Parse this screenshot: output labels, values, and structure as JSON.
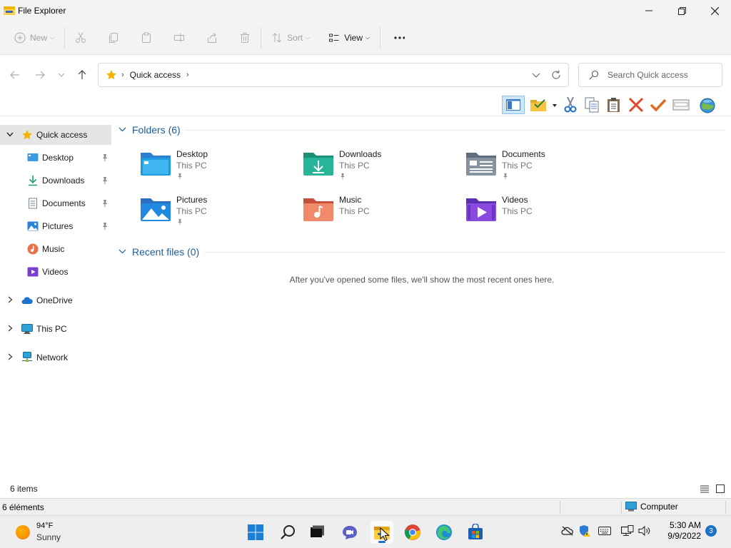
{
  "window": {
    "title": "File Explorer",
    "icon": "file-explorer-icon"
  },
  "commandbar": {
    "new_label": "New",
    "sort_label": "Sort",
    "view_label": "View",
    "icons": [
      "new-icon",
      "cut-icon",
      "copy-icon",
      "paste-icon",
      "rename-icon",
      "share-icon",
      "delete-icon",
      "sort-icon",
      "view-icon",
      "more-icon"
    ]
  },
  "address": {
    "crumb": "Quick access",
    "search_placeholder": "Search Quick access"
  },
  "legacy_toolbar": {
    "icons": [
      "details-pane-icon",
      "folder-check-icon",
      "cut-icon",
      "copy-icon",
      "paste-icon",
      "delete-icon",
      "check-icon",
      "properties-icon",
      "globe-icon"
    ]
  },
  "nav": {
    "quick_access": "Quick access",
    "items": [
      {
        "label": "Desktop",
        "icon": "desktop-icon",
        "pinned": true
      },
      {
        "label": "Downloads",
        "icon": "downloads-icon",
        "pinned": true
      },
      {
        "label": "Documents",
        "icon": "documents-icon",
        "pinned": true
      },
      {
        "label": "Pictures",
        "icon": "pictures-icon",
        "pinned": true
      },
      {
        "label": "Music",
        "icon": "music-icon",
        "pinned": false
      },
      {
        "label": "Videos",
        "icon": "videos-icon",
        "pinned": false
      }
    ],
    "roots": [
      {
        "label": "OneDrive",
        "icon": "onedrive-icon"
      },
      {
        "label": "This PC",
        "icon": "this-pc-icon"
      },
      {
        "label": "Network",
        "icon": "network-icon"
      }
    ]
  },
  "content": {
    "folders_header": "Folders (6)",
    "recent_header": "Recent files (0)",
    "empty_message": "After you've opened some files, we'll show the most recent ones here.",
    "folders": [
      {
        "name": "Desktop",
        "location": "This PC",
        "pinned": true,
        "color": "#1e88e5"
      },
      {
        "name": "Downloads",
        "location": "This PC",
        "pinned": true,
        "color": "#26a69a"
      },
      {
        "name": "Documents",
        "location": "This PC",
        "pinned": true,
        "color": "#78909c"
      },
      {
        "name": "Pictures",
        "location": "This PC",
        "pinned": true,
        "color": "#1e88e5"
      },
      {
        "name": "Music",
        "location": "This PC",
        "pinned": false,
        "color": "#ef6c4f"
      },
      {
        "name": "Videos",
        "location": "This PC",
        "pinned": false,
        "color": "#7e3fd6"
      }
    ]
  },
  "status": {
    "item_count": "6 items",
    "legacy_count": "6 éléments",
    "legacy_location": "Computer"
  },
  "taskbar": {
    "weather_temp": "94°F",
    "weather_condition": "Sunny",
    "apps": [
      "start-icon",
      "search-icon",
      "task-view-icon",
      "chat-icon",
      "file-explorer-icon",
      "chrome-icon",
      "edge-icon",
      "store-icon"
    ],
    "active_app": "file-explorer-icon",
    "time": "5:30 AM",
    "date": "9/9/2022",
    "notification_count": "3"
  },
  "colors": {
    "accent": "#1f6fc4",
    "group_header": "#1c5d99",
    "selection": "#e5e5e5"
  }
}
